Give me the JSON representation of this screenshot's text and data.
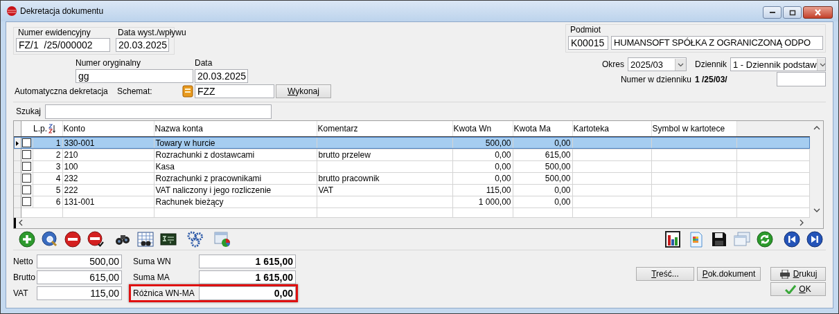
{
  "window": {
    "title": "Dekretacja dokumentu"
  },
  "numer_ewidencyjny": {
    "label": "Numer ewidencyjny",
    "value": "FZ/1  /25/000002"
  },
  "data_wystawienia": {
    "label": "Data wyst./wpływu",
    "value": "20.03.2025"
  },
  "podmiot": {
    "label": "Podmiot",
    "code": "K00015",
    "name": "HUMANSOFT SPÓŁKA Z OGRANICZONĄ ODPO"
  },
  "numer_oryginalny": {
    "label": "Numer oryginalny",
    "value": "gg"
  },
  "data": {
    "label": "Data",
    "value": "20.03.2025"
  },
  "okres": {
    "label": "Okres",
    "value": "2025/03"
  },
  "dziennik": {
    "label": "Dziennik",
    "value": "1 - Dziennik podstaw"
  },
  "automatyczna_dekretacja": {
    "label": "Automatyczna dekretacja",
    "schemat_label": "Schemat:",
    "schemat": "FZZ",
    "button": "Wykonaj"
  },
  "numer_w_dzienniku": {
    "label": "Numer w dzienniku",
    "value": "1 /25/03/"
  },
  "search": {
    "label": "Szukaj"
  },
  "table": {
    "columns": [
      "L.p.",
      "Konto",
      "Nazwa konta",
      "Komentarz",
      "Kwota Wn",
      "Kwota Ma",
      "Kartoteka",
      "Symbol w kartotece"
    ],
    "rows": [
      {
        "lp": "1",
        "konto": "330-001",
        "nazwa": "Towary w hurcie",
        "komentarz": "",
        "wn": "500,00",
        "ma": "0,00",
        "selected": true,
        "checked": false
      },
      {
        "lp": "2",
        "konto": "210",
        "nazwa": "Rozrachunki z dostawcami",
        "komentarz": "brutto przelew",
        "wn": "0,00",
        "ma": "615,00",
        "selected": false,
        "checked": false
      },
      {
        "lp": "3",
        "konto": "100",
        "nazwa": "Kasa",
        "komentarz": "",
        "wn": "0,00",
        "ma": "500,00",
        "selected": false,
        "checked": false
      },
      {
        "lp": "4",
        "konto": "232",
        "nazwa": "Rozrachunki z pracownikami",
        "komentarz": "brutto pracownik",
        "wn": "0,00",
        "ma": "500,00",
        "selected": false,
        "checked": false
      },
      {
        "lp": "5",
        "konto": "222",
        "nazwa": "VAT naliczony i jego rozliczenie",
        "komentarz": "VAT",
        "wn": "115,00",
        "ma": "0,00",
        "selected": false,
        "checked": false
      },
      {
        "lp": "6",
        "konto": "131-001",
        "nazwa": "Rachunek bieżący",
        "komentarz": "",
        "wn": "1 000,00",
        "ma": "0,00",
        "selected": false,
        "checked": false
      }
    ]
  },
  "summary_left": [
    {
      "label": "Netto",
      "value": "500,00"
    },
    {
      "label": "Brutto",
      "value": "615,00"
    },
    {
      "label": "VAT",
      "value": "115,00"
    }
  ],
  "summary_right": [
    {
      "label": "Suma WN",
      "value": "1 615,00",
      "highlighted": false
    },
    {
      "label": "Suma MA",
      "value": "1 615,00",
      "highlighted": false
    },
    {
      "label": "Różnica WN-MA",
      "value": "0,00",
      "highlighted": true
    }
  ],
  "buttons": [
    {
      "label": "Treść..."
    },
    {
      "label": "Pok.dokument"
    }
  ],
  "side_buttons": [
    {
      "label": "Drukuj",
      "kind": "print"
    },
    {
      "label": "OK",
      "kind": "confirm"
    }
  ]
}
